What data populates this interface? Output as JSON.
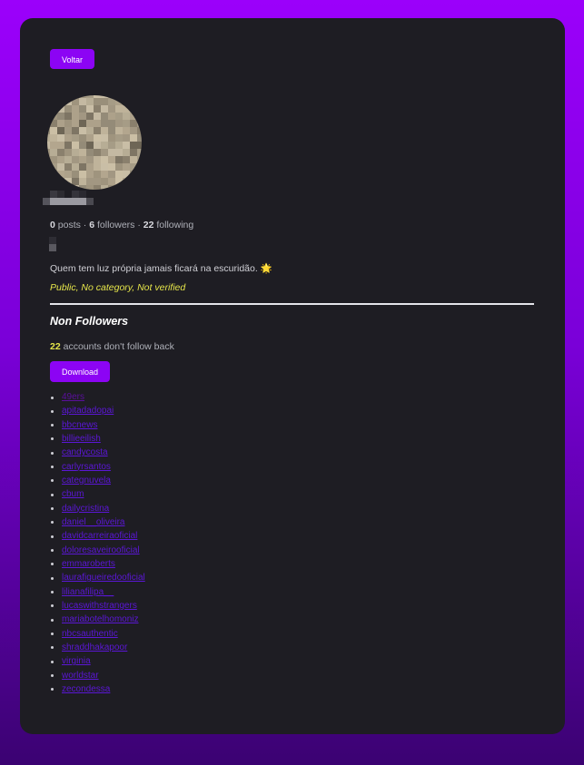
{
  "back_button": "Voltar",
  "profile": {
    "posts": "0",
    "followers": "6",
    "following": "22",
    "posts_label": "posts",
    "followers_label": "followers",
    "following_label": "following",
    "separator": "·",
    "bio": "Quem tem luz própria jamais ficará na escuridão.",
    "bio_emoji": "🌟",
    "meta": "Public, No category, Not verified"
  },
  "non_followers": {
    "title": "Non Followers",
    "count": "22",
    "count_label": "accounts don't follow back",
    "download_button": "Download",
    "users": [
      "49ers",
      "apitadadopai",
      "bbcnews",
      "billieeilish",
      "candycosta",
      "carlyrsantos",
      "categnuvela",
      "cbum",
      "dailycristina",
      "daniel__oliveira",
      "davidcarreiraoficial",
      "doloresaveirooficial",
      "emmaroberts",
      "laurafigueiredooficial",
      "lilianafilipa__",
      "lucaswithstrangers",
      "mariabotelhomoniz",
      "nbcsauthentic",
      "shraddhakapoor",
      "virginia",
      "worldstar",
      "zecondessa"
    ]
  },
  "colors": {
    "accent": "#8c04f4",
    "card": "#1e1d23",
    "highlight": "#e6e64a",
    "link": "#5b16d6"
  }
}
